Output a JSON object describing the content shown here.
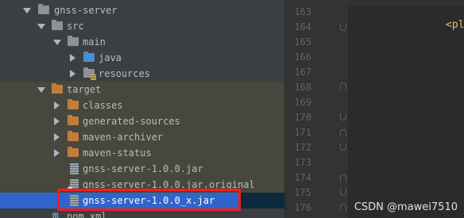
{
  "project_tree": {
    "items": [
      {
        "label": "gnss-server"
      },
      {
        "label": "src"
      },
      {
        "label": "main"
      },
      {
        "label": "java"
      },
      {
        "label": "resources"
      },
      {
        "label": "target"
      },
      {
        "label": "classes"
      },
      {
        "label": "generated-sources"
      },
      {
        "label": "maven-archiver"
      },
      {
        "label": "maven-status"
      },
      {
        "label": "gnss-server-1.0.0.jar"
      },
      {
        "label": "gnss-server-1.0.0.jar.original"
      },
      {
        "label": "gnss-server-1.0.0_x.jar"
      },
      {
        "label": "pom.xml"
      }
    ]
  },
  "line_numbers": [
    "163",
    "164",
    "165",
    "166",
    "167",
    "168",
    "169",
    "170",
    "171",
    "172",
    "173",
    "174",
    "175",
    "176"
  ],
  "editor": {
    "code_fragment": "<pl"
  },
  "watermark": "CSDN @mawei7510",
  "colors": {
    "highlight_box": "#ff1a1a",
    "selection": "#2f65ca"
  }
}
